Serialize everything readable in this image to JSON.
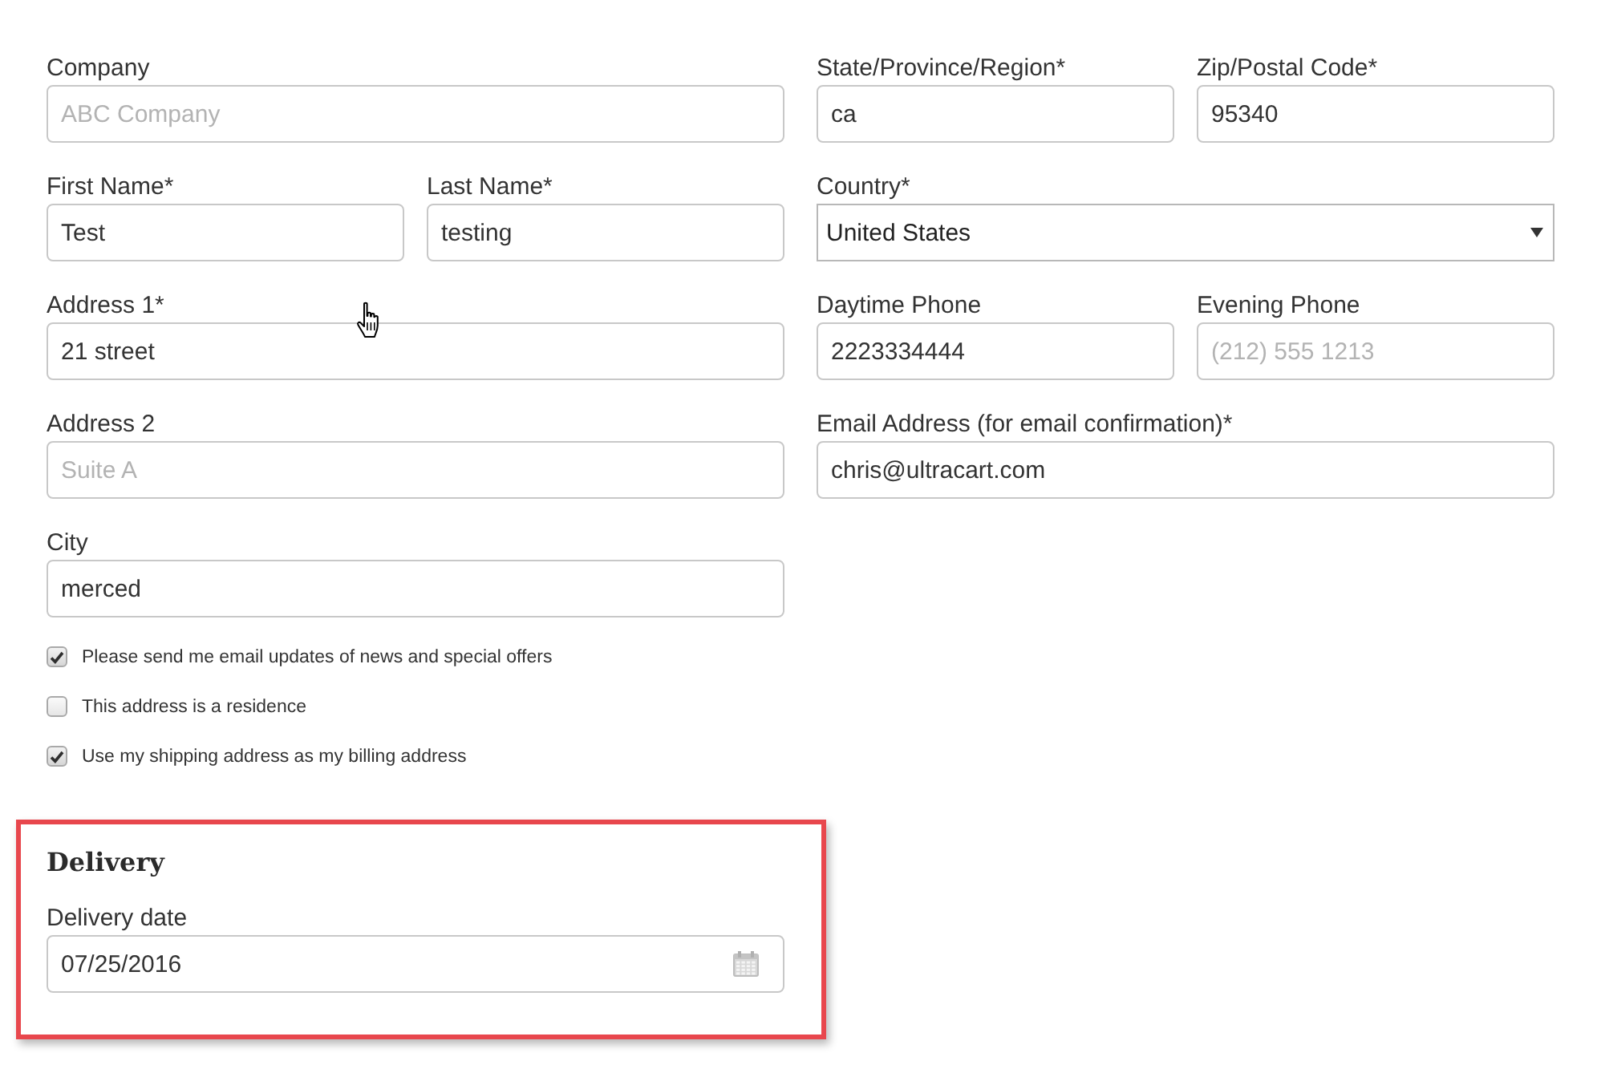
{
  "left_rows": [
    {
      "fields": [
        {
          "label": "Company",
          "placeholder": "ABC Company",
          "kind": "text"
        }
      ]
    },
    {
      "fields": [
        {
          "label": "First Name*",
          "value": "Test",
          "kind": "text"
        },
        {
          "label": "Last Name*",
          "value": "testing",
          "kind": "text"
        }
      ]
    },
    {
      "fields": [
        {
          "label": "Address 1*",
          "value": "21 street",
          "kind": "text"
        }
      ]
    },
    {
      "fields": [
        {
          "label": "Address 2",
          "placeholder": "Suite A",
          "kind": "text"
        }
      ]
    },
    {
      "fields": [
        {
          "label": "City",
          "value": "merced",
          "kind": "text"
        }
      ]
    }
  ],
  "checkboxes": [
    {
      "label": "Please send me email updates of news and special offers",
      "checked": true
    },
    {
      "label": "This address is a residence",
      "checked": false
    },
    {
      "label": "Use my shipping address as my billing address",
      "checked": true
    }
  ],
  "delivery": {
    "highlighted": true,
    "title": "Delivery",
    "field": {
      "label": "Delivery date",
      "value": "07/25/2016",
      "kind": "date"
    }
  },
  "right_rows": [
    {
      "fields": [
        {
          "label": "State/Province/Region*",
          "value": "ca",
          "kind": "text"
        },
        {
          "label": "Zip/Postal Code*",
          "value": "95340",
          "kind": "text"
        }
      ]
    },
    {
      "fields": [
        {
          "label": "Country*",
          "value": "United States",
          "kind": "select"
        }
      ]
    },
    {
      "fields": [
        {
          "label": "Daytime Phone",
          "value": "2223334444",
          "kind": "text"
        },
        {
          "label": "Evening Phone",
          "placeholder": "(212) 555 1213",
          "kind": "text"
        }
      ]
    },
    {
      "fields": [
        {
          "label": "Email Address (for email confirmation)*",
          "value": "chris@ultracart.com",
          "kind": "text"
        }
      ]
    }
  ]
}
